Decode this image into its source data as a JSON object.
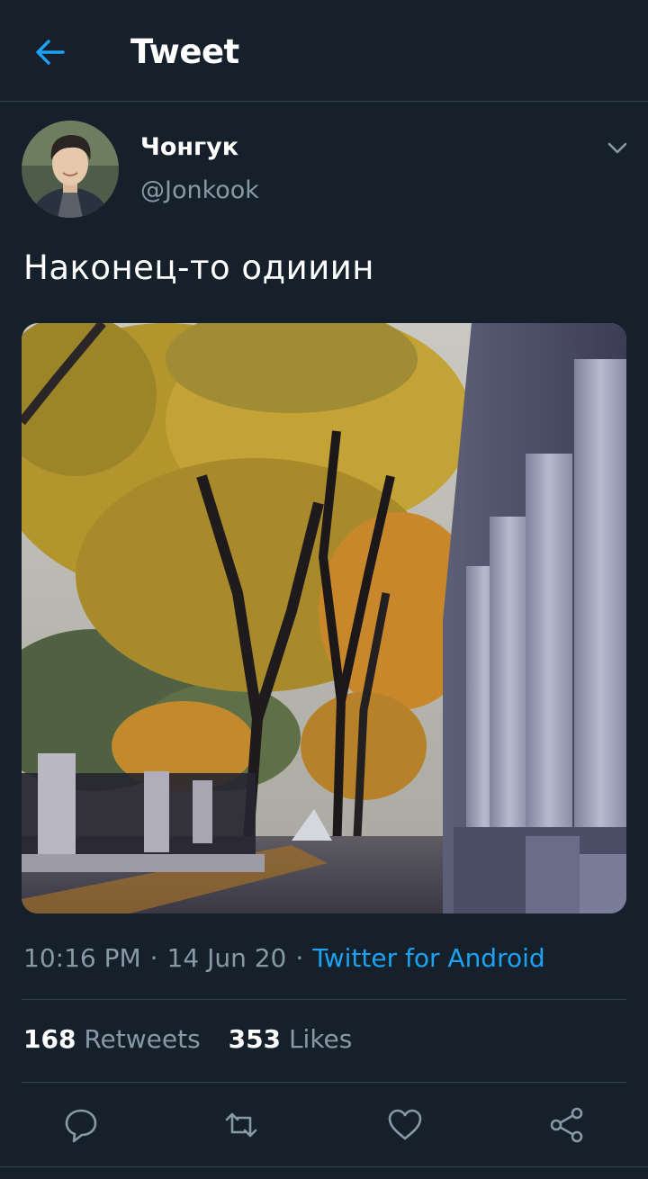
{
  "header": {
    "title": "Tweet",
    "back_icon": "arrow-left-icon"
  },
  "tweet": {
    "author": {
      "name": "Чонгук",
      "handle": "@Jonkook"
    },
    "text": "Наконец-то одииин",
    "meta": {
      "time": "10:16 PM",
      "separator": "·",
      "date": "14 Jun 20",
      "source": "Twitter for Android"
    },
    "stats": {
      "retweets_count": "168",
      "retweets_label": "Retweets",
      "likes_count": "353",
      "likes_label": "Likes"
    },
    "actions": [
      "reply-icon",
      "retweet-icon",
      "like-icon",
      "share-icon"
    ]
  },
  "colors": {
    "background": "#15202b",
    "accent": "#1da1f2",
    "secondary_text": "#8899a6",
    "divider": "#38444d"
  }
}
